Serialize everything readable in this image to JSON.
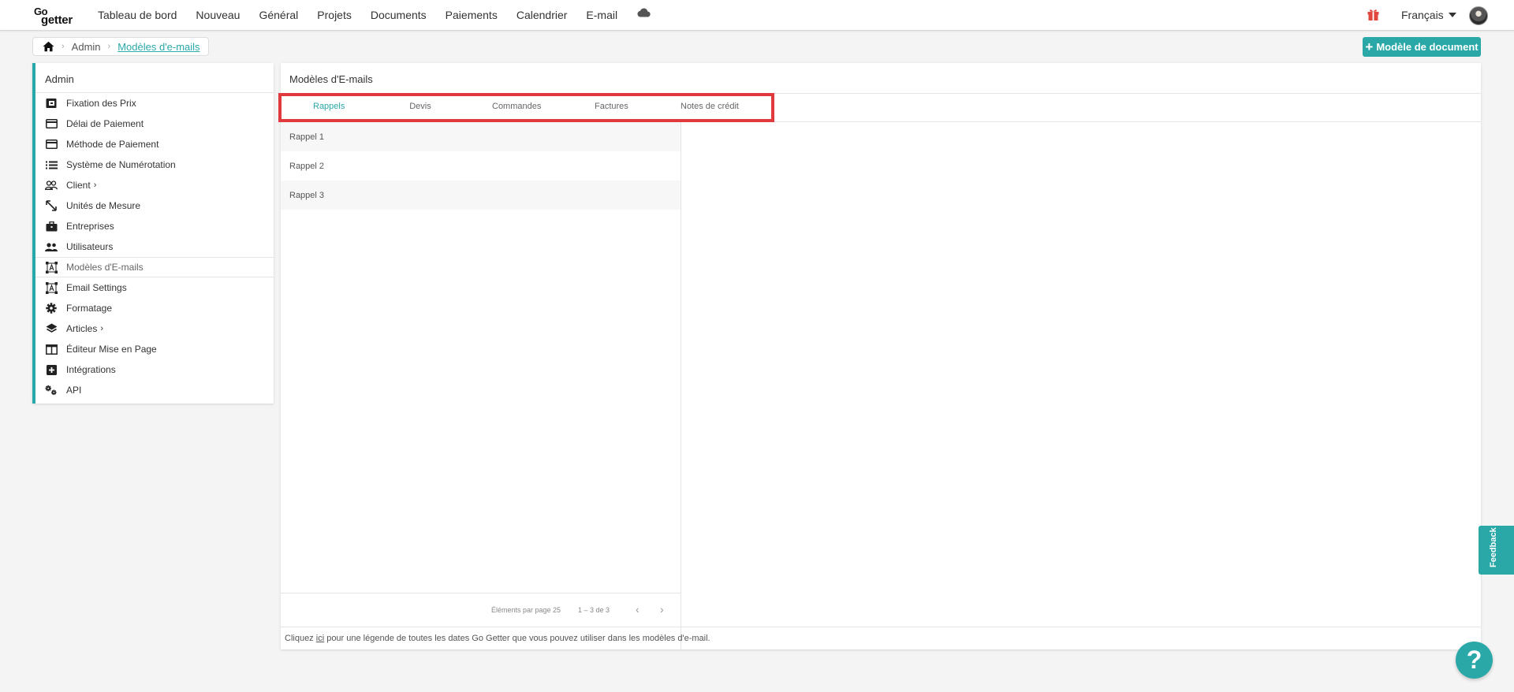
{
  "brand": {
    "line1": "Go",
    "line2": "getter",
    "accent": "#2aa8a8"
  },
  "nav": {
    "items": [
      "Tableau de bord",
      "Nouveau",
      "Général",
      "Projets",
      "Documents",
      "Paiements",
      "Calendrier",
      "E-mail"
    ],
    "cloud_icon": "cloud-icon",
    "gift_icon": "gift-icon",
    "language": "Français"
  },
  "breadcrumb": {
    "home_icon": "home-icon",
    "parent": "Admin",
    "current": "Modèles d'e-mails"
  },
  "actions": {
    "new_document": "Modèle de document"
  },
  "sidebar": {
    "title": "Admin",
    "items": [
      {
        "label": "Fixation des Prix",
        "icon": "pricing-icon",
        "chevron": false,
        "active": false
      },
      {
        "label": "Délai de Paiement",
        "icon": "credit-card-icon",
        "chevron": false,
        "active": false
      },
      {
        "label": "Méthode de Paiement",
        "icon": "credit-card-icon",
        "chevron": false,
        "active": false
      },
      {
        "label": "Système de Numérotation",
        "icon": "list-icon",
        "chevron": false,
        "active": false
      },
      {
        "label": "Client",
        "icon": "people-outline-icon",
        "chevron": true,
        "active": false
      },
      {
        "label": "Unités de Mesure",
        "icon": "resize-arrows-icon",
        "chevron": false,
        "active": false
      },
      {
        "label": "Entreprises",
        "icon": "briefcase-icon",
        "chevron": false,
        "active": false
      },
      {
        "label": "Utilisateurs",
        "icon": "people-icon",
        "chevron": false,
        "active": false
      },
      {
        "label": "Modèles d'E-mails",
        "icon": "text-frame-icon",
        "chevron": false,
        "active": true
      },
      {
        "label": "Email Settings",
        "icon": "text-frame-icon",
        "chevron": false,
        "active": false
      },
      {
        "label": "Formatage",
        "icon": "gear-icon",
        "chevron": false,
        "active": false
      },
      {
        "label": "Articles",
        "icon": "layers-icon",
        "chevron": true,
        "active": false
      },
      {
        "label": "Éditeur Mise en Page",
        "icon": "layout-icon",
        "chevron": false,
        "active": false
      },
      {
        "label": "Intégrations",
        "icon": "plus-box-icon",
        "chevron": false,
        "active": false
      },
      {
        "label": "API",
        "icon": "gears-icon",
        "chevron": false,
        "active": false
      }
    ]
  },
  "main": {
    "title": "Modèles d'E-mails",
    "tabs": [
      {
        "label": "Rappels",
        "active": true
      },
      {
        "label": "Devis",
        "active": false
      },
      {
        "label": "Commandes",
        "active": false
      },
      {
        "label": "Factures",
        "active": false
      },
      {
        "label": "Notes de crédit",
        "active": false
      }
    ],
    "list": [
      "Rappel 1",
      "Rappel 2",
      "Rappel 3"
    ],
    "pager": {
      "label": "Éléments par page 25",
      "range": "1 – 3 de 3",
      "prev": "‹",
      "next": "›"
    },
    "footer": {
      "before": "Cliquez ",
      "link": "ici",
      "after": " pour une légende de toutes les dates Go Getter que vous pouvez utiliser dans les modèles d'e-mail."
    }
  },
  "feedback": "Feedback",
  "help": "?"
}
